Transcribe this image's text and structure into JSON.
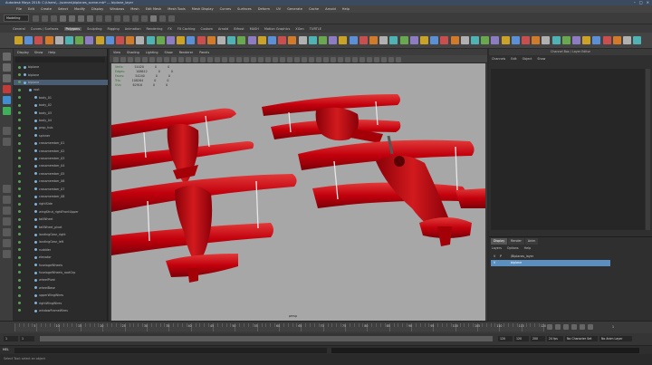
{
  "app": {
    "title": "Autodesk Maya 2018: C:\\Users\\...\\scenes\\biplanes_scene.mb* --- biplane_layer"
  },
  "menu": [
    "File",
    "Edit",
    "Create",
    "Select",
    "Modify",
    "Display",
    "Windows",
    "Mesh",
    "Edit Mesh",
    "Mesh Tools",
    "Mesh Display",
    "Curves",
    "Surfaces",
    "Deform",
    "UV",
    "Generate",
    "Cache",
    "Arnold",
    "Help"
  ],
  "status_line": {
    "mode": "Modeling"
  },
  "shelf_tabs": [
    "General",
    "Curves / Surfaces",
    "Polygons",
    "Sculpting",
    "Rigging",
    "Animation",
    "Rendering",
    "FX",
    "FX Caching",
    "Custom",
    "Arnold",
    "Bifrost",
    "MASH",
    "Motion Graphics",
    "XGen",
    "TURTLE"
  ],
  "shelf_active_tab": "Polygons",
  "outliner": {
    "menus": [
      "Display",
      "Show",
      "Help"
    ],
    "items": [
      "biplane",
      "biplane",
      "biplane",
      "root",
      "body_01",
      "body_02",
      "body_03",
      "body_04",
      "prop_hub",
      "spinner",
      "crossmember_01",
      "crossmember_02",
      "crossmember_03",
      "crossmember_04",
      "crossmember_05",
      "crossmember_06",
      "crossmember_07",
      "crossmember_08",
      "rightSide",
      "wingStrut_rightFrontUpper",
      "tailWheel",
      "tailWheel_pivot",
      "landingGear_right",
      "landingGear_left",
      "ruddder",
      "elevator",
      "fuselageWheels",
      "fuselageWheels_rootGrp",
      "wheelPivot",
      "wheelBase",
      "upperWingWires",
      "rightWingWires",
      "windowFrameWires"
    ],
    "selected_index": 2
  },
  "viewport": {
    "menus": [
      "View",
      "Shading",
      "Lighting",
      "Show",
      "Renderer",
      "Panels"
    ],
    "hud": [
      {
        "label": "Verts:",
        "a": "54420",
        "b": "0",
        "c": "0"
      },
      {
        "label": "Edges:",
        "a": "108612",
        "b": "0",
        "c": "0"
      },
      {
        "label": "Faces:",
        "a": "54240",
        "b": "0",
        "c": "0"
      },
      {
        "label": "Tris:",
        "a": "108264",
        "b": "0",
        "c": "0"
      },
      {
        "label": "UVs:",
        "a": "62916",
        "b": "0",
        "c": "0"
      }
    ],
    "camera": "persp"
  },
  "attribute_editor": {
    "title": "Channel Box / Layer Editor",
    "menus": [
      "Channels",
      "Edit",
      "Object",
      "Show"
    ]
  },
  "layers": {
    "tabs": [
      "Display",
      "Render",
      "Anim"
    ],
    "active_tab": "Display",
    "menus": [
      "Layers",
      "Options",
      "Help"
    ],
    "rows": [
      {
        "v": "V",
        "p": "P",
        "name": "/Biplanes_layer",
        "selected": false
      },
      {
        "v": "V",
        "p": "",
        "name": "biplane",
        "selected": true
      }
    ]
  },
  "timeline": {
    "start": "1",
    "ticks": [
      "5",
      "10",
      "15",
      "20",
      "25",
      "30",
      "35",
      "40",
      "45",
      "50",
      "55",
      "60",
      "65",
      "70",
      "75",
      "80",
      "85",
      "90",
      "95",
      "100",
      "105",
      "110",
      "115",
      "120"
    ],
    "current": "1"
  },
  "range": {
    "start": "1",
    "inner_start": "1",
    "inner_end": "120",
    "end": "120",
    "end2": "200",
    "fps": "24 fps",
    "char_set": "No Character Set",
    "anim_layer": "No Anim Layer"
  },
  "command_line": {
    "lang": "MEL"
  },
  "help_line": "Select Tool: select an object",
  "colors": {
    "plane_red": "#c2000c",
    "plane_dark": "#8a0008",
    "viewport_bg": "#a7a7a7",
    "selection": "#5a8fbf"
  }
}
